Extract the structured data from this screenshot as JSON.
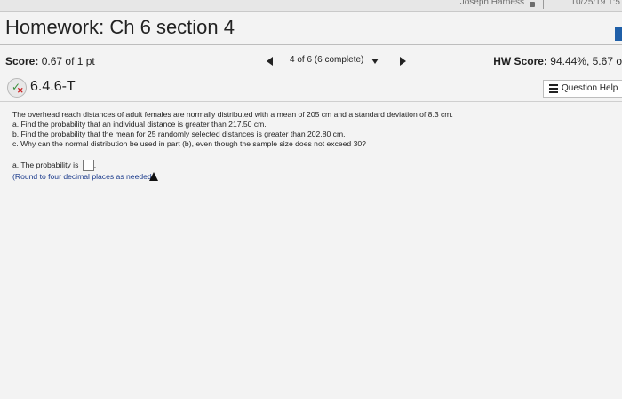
{
  "os": {
    "user_fragment": "Joseph Harness",
    "datetime_fragment": "10/25/19 1:5"
  },
  "page": {
    "title": "Homework: Ch 6 section 4"
  },
  "score_row": {
    "score_label": "Score:",
    "score_value": "0.67 of 1 pt",
    "nav_text": "4 of 6 (6 complete)",
    "hw_label": "HW Score:",
    "hw_value": "94.44%, 5.67 o"
  },
  "question": {
    "id": "6.4.6-T",
    "help_label": "Question Help"
  },
  "problem": {
    "lines": [
      "The overhead reach distances of adult females are normally distributed with a mean of 205 cm and a standard deviation of 8.3 cm.",
      "a. Find the probability that an individual distance is greater than 217.50 cm.",
      "b. Find the probability that the mean for 25 randomly selected distances is greater than 202.80 cm.",
      "c. Why can the normal distribution be used in part (b), even though the sample size does not exceed 30?"
    ]
  },
  "answer": {
    "prompt": "a. The probability is",
    "instruction": "(Round to four decimal places as needed.)",
    "value": ""
  },
  "colors": {
    "instruction_text": "#1b3b8c",
    "side_tab": "#1f5fa8"
  }
}
